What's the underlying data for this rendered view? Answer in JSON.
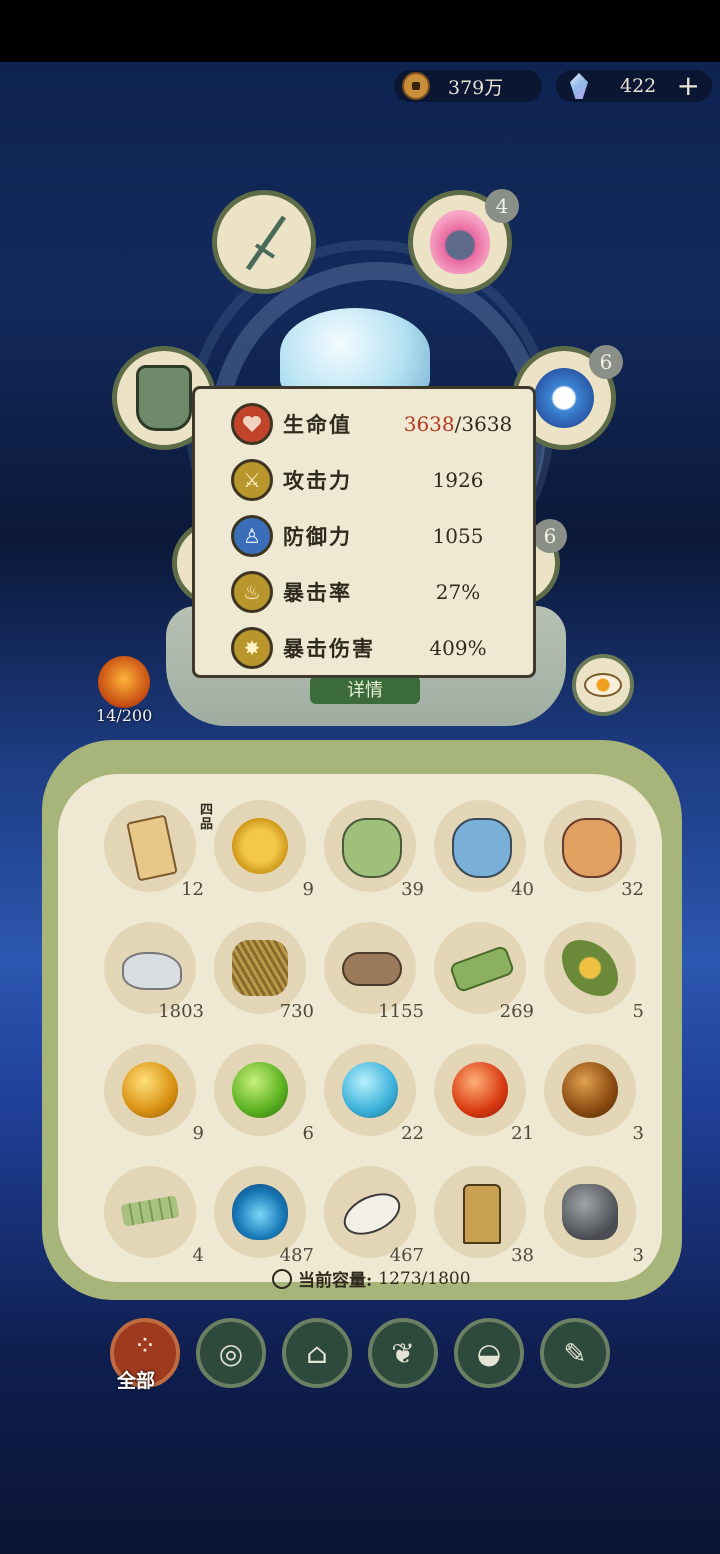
{
  "currency": {
    "coins": "379万",
    "gems": "422"
  },
  "equipment": {
    "slot_badges": {
      "top_right": "4",
      "mid_right": "6",
      "lower_right_partial": "6"
    }
  },
  "stats": [
    {
      "label": "生命值",
      "value_current": "3638",
      "value_rest": "/3638",
      "icon": "heart-icon",
      "color": "#c1432b"
    },
    {
      "label": "攻击力",
      "value": "1926",
      "icon": "sword-slash-icon",
      "color": "#b8962c"
    },
    {
      "label": "防御力",
      "value": "1055",
      "icon": "person-shield-icon",
      "color": "#3b6eb8"
    },
    {
      "label": "暴击率",
      "value": "27%",
      "icon": "flame-icon",
      "color": "#b8962c"
    },
    {
      "label": "暴击伤害",
      "value": "409%",
      "icon": "burst-icon",
      "color": "#b8962c"
    }
  ],
  "details_button": "详情",
  "avatar_count": "14/200",
  "inventory": {
    "items": [
      {
        "icon": "scroll-icon",
        "count": "12",
        "tag": ""
      },
      {
        "icon": "grape-fruit-icon",
        "count": "9",
        "tag": "四品"
      },
      {
        "icon": "green-pouch-icon",
        "count": "39",
        "tag": ""
      },
      {
        "icon": "blue-pouch-icon",
        "count": "40",
        "tag": ""
      },
      {
        "icon": "orange-pouch-icon",
        "count": "32",
        "tag": ""
      },
      {
        "icon": "stone-icon",
        "count": "1803",
        "tag": ""
      },
      {
        "icon": "straw-bundle-icon",
        "count": "730",
        "tag": ""
      },
      {
        "icon": "log-icon",
        "count": "1155",
        "tag": ""
      },
      {
        "icon": "bamboo-icon",
        "count": "269",
        "tag": ""
      },
      {
        "icon": "herb-flower-icon",
        "count": "5",
        "tag": ""
      },
      {
        "icon": "gold-orb-icon",
        "count": "9",
        "tag": ""
      },
      {
        "icon": "green-orb-icon",
        "count": "6",
        "tag": ""
      },
      {
        "icon": "blue-orb-icon",
        "count": "22",
        "tag": ""
      },
      {
        "icon": "red-orb-icon",
        "count": "21",
        "tag": ""
      },
      {
        "icon": "brown-orb-icon",
        "count": "3",
        "tag": ""
      },
      {
        "icon": "bamboo-slips-icon",
        "count": "4",
        "tag": ""
      },
      {
        "icon": "spirit-flame-icon",
        "count": "487",
        "tag": ""
      },
      {
        "icon": "white-stone-icon",
        "count": "467",
        "tag": ""
      },
      {
        "icon": "token-icon",
        "count": "38",
        "tag": ""
      },
      {
        "icon": "dark-ore-icon",
        "count": "3",
        "tag": ""
      }
    ],
    "capacity_label": "当前容量:",
    "capacity_value": "1273/1800"
  },
  "tabs": [
    {
      "icon": "grid-icon",
      "label": "全部",
      "active": true
    },
    {
      "icon": "log-tab-icon",
      "label": "",
      "active": false
    },
    {
      "icon": "house-icon",
      "label": "",
      "active": false
    },
    {
      "icon": "leaf-icon",
      "label": "",
      "active": false
    },
    {
      "icon": "bowl-icon",
      "label": "",
      "active": false
    },
    {
      "icon": "scroll-tab-icon",
      "label": "",
      "active": false
    }
  ]
}
